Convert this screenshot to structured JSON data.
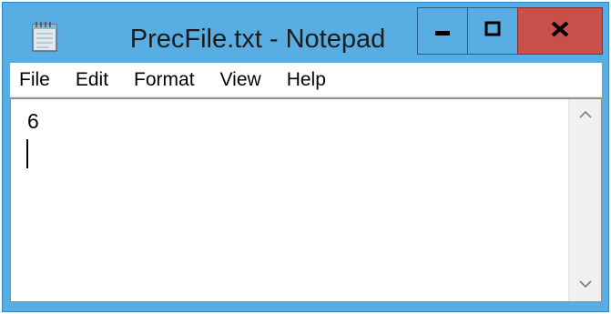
{
  "window": {
    "title": "PrecFile.txt - Notepad",
    "frame_color": "#58aee2",
    "close_color": "#c7504a"
  },
  "menu": {
    "items": [
      {
        "label": "File"
      },
      {
        "label": "Edit"
      },
      {
        "label": "Format"
      },
      {
        "label": "View"
      },
      {
        "label": "Help"
      }
    ]
  },
  "editor": {
    "content": "6"
  },
  "icons": {
    "app": "notepad-icon",
    "minimize": "minimize-icon",
    "maximize": "maximize-icon",
    "close": "close-icon",
    "scroll_up": "chevron-up-icon",
    "scroll_down": "chevron-down-icon"
  }
}
